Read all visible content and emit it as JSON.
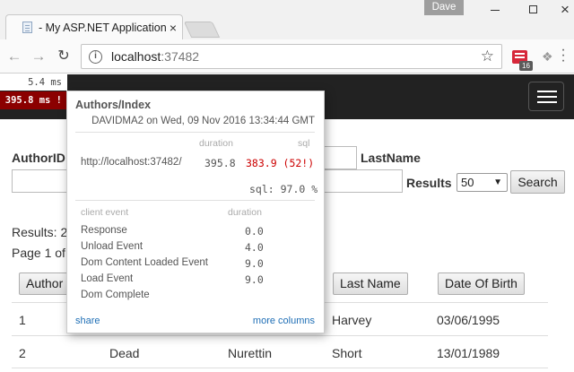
{
  "browser": {
    "tab_title": "- My ASP.NET Application",
    "tab_close": "×",
    "profile_name": "Dave",
    "url_host": "localhost",
    "url_port": ":37482",
    "ext_badge": "16",
    "icons": {
      "back": "back-arrow-icon",
      "forward": "forward-arrow-icon",
      "reload": "reload-icon",
      "star": "bookmark-star-icon"
    }
  },
  "miniprofiler": {
    "badge_time": "5.4 ms",
    "badge_time_slow": "395.8 ms !",
    "title": "Authors/Index",
    "subtitle": "DAVIDMA2 on Wed, 09 Nov 2016 13:34:44 GMT",
    "col_duration": "duration",
    "col_sql": "sql",
    "url": "http://localhost:37482/",
    "duration": "395.8",
    "sql": "383.9 (52!)",
    "sql_pct": "sql: 97.0 %",
    "event_header": "client event",
    "event_duration_header": "duration",
    "events": [
      {
        "name": "Response",
        "duration": "0.0"
      },
      {
        "name": "Unload Event",
        "duration": "4.0"
      },
      {
        "name": "Dom Content Loaded Event",
        "duration": "9.0"
      },
      {
        "name": "Load Event",
        "duration": "9.0"
      },
      {
        "name": "Dom Complete",
        "duration": ""
      }
    ],
    "share": "share",
    "more_columns": "more columns",
    "colors": {
      "slow": "#8b0000",
      "sql": "#cc0000",
      "link": "#1e6eb5"
    }
  },
  "page": {
    "filter_label_authorid": "AuthorID",
    "filter_label_lastname": "LastName",
    "results_label": "Results",
    "results_value": "50",
    "search_button": "Search",
    "results_text": "Results: 2",
    "page_text": "Page 1 of",
    "headers": {
      "author": "Author",
      "last_name": "Last Name",
      "dob": "Date Of Birth"
    },
    "rows": [
      {
        "id": "1",
        "col2": "",
        "col3": "",
        "last_name": "Harvey",
        "dob": "03/06/1995"
      },
      {
        "id": "2",
        "col2": "Dead",
        "col3": "Nurettin",
        "last_name": "Short",
        "dob": "13/01/1989"
      }
    ]
  }
}
